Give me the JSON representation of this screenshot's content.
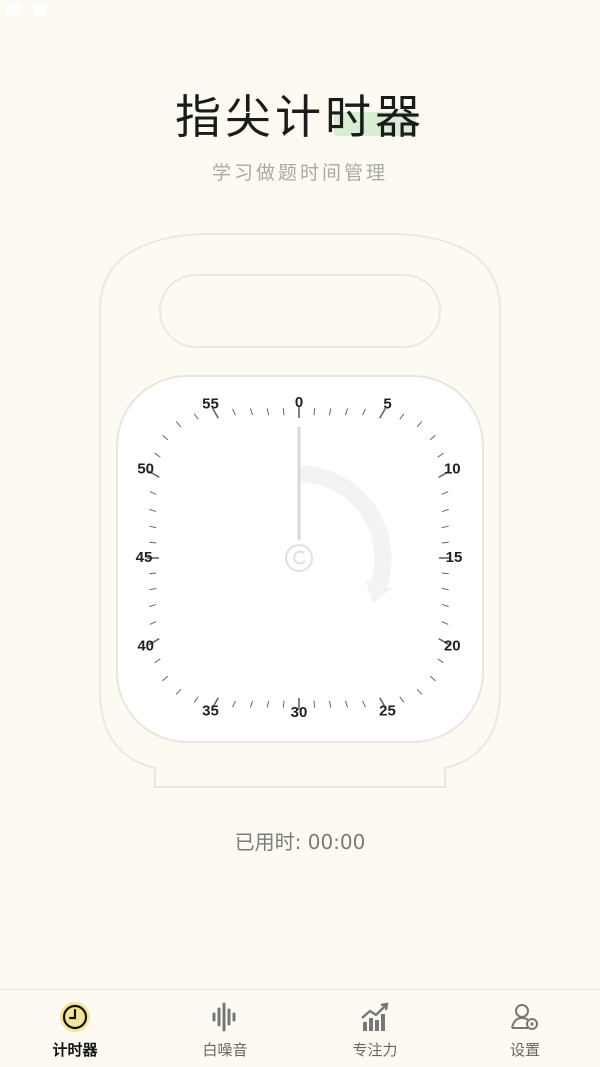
{
  "app": {
    "title": "指尖计时器",
    "subtitle": "学习做题时间管理"
  },
  "timer": {
    "dial_labels": [
      "0",
      "5",
      "10",
      "15",
      "20",
      "25",
      "30",
      "35",
      "40",
      "45",
      "50",
      "55"
    ],
    "progress_fraction": 0.3,
    "elapsed_text": "已用时: 00:00"
  },
  "tabs": [
    {
      "label": "计时器",
      "icon": "clock-icon",
      "active": true
    },
    {
      "label": "白噪音",
      "icon": "sound-wave-icon",
      "active": false
    },
    {
      "label": "专注力",
      "icon": "trend-chart-icon",
      "active": false
    },
    {
      "label": "设置",
      "icon": "user-settings-icon",
      "active": false
    }
  ],
  "colors": {
    "background": "#fdfaf2",
    "title_highlight": "#d7eed3",
    "active_tab_icon": "#f4e49a"
  }
}
